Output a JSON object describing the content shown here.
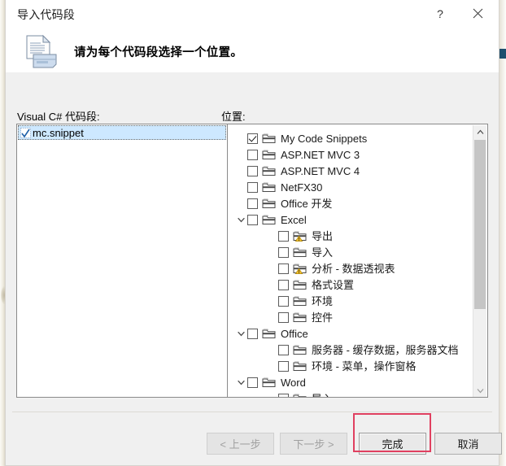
{
  "window": {
    "title": "导入代码段",
    "help_label": "?",
    "close_label": "×"
  },
  "header": {
    "instruction": "请为每个代码段选择一个位置。",
    "icon": "snippet-document-icon"
  },
  "left_panel": {
    "label": "Visual C# 代码段:",
    "items": [
      {
        "label": "mc.snippet",
        "checked": true,
        "selected": true
      }
    ]
  },
  "right_panel": {
    "label": "位置:",
    "tree": [
      {
        "label": "My Code Snippets",
        "checked": true,
        "depth": 0,
        "expander": "none",
        "warn": false
      },
      {
        "label": "ASP.NET MVC 3",
        "checked": false,
        "depth": 0,
        "expander": "none",
        "warn": false
      },
      {
        "label": "ASP.NET MVC 4",
        "checked": false,
        "depth": 0,
        "expander": "none",
        "warn": false
      },
      {
        "label": "NetFX30",
        "checked": false,
        "depth": 0,
        "expander": "none",
        "warn": false
      },
      {
        "label": "Office 开发",
        "checked": false,
        "depth": 0,
        "expander": "none",
        "warn": false
      },
      {
        "label": "Excel",
        "checked": false,
        "depth": 0,
        "expander": "expanded",
        "warn": false
      },
      {
        "label": "导出",
        "checked": false,
        "depth": 1,
        "expander": "none",
        "warn": true
      },
      {
        "label": "导入",
        "checked": false,
        "depth": 1,
        "expander": "none",
        "warn": false
      },
      {
        "label": "分析 - 数据透视表",
        "checked": false,
        "depth": 1,
        "expander": "none",
        "warn": true
      },
      {
        "label": "格式设置",
        "checked": false,
        "depth": 1,
        "expander": "none",
        "warn": false
      },
      {
        "label": "环境",
        "checked": false,
        "depth": 1,
        "expander": "none",
        "warn": false
      },
      {
        "label": "控件",
        "checked": false,
        "depth": 1,
        "expander": "none",
        "warn": false
      },
      {
        "label": "Office",
        "checked": false,
        "depth": 0,
        "expander": "expanded",
        "warn": false
      },
      {
        "label": "服务器 - 缓存数据，服务器文档",
        "checked": false,
        "depth": 1,
        "expander": "none",
        "warn": false
      },
      {
        "label": "环境 - 菜单，操作窗格",
        "checked": false,
        "depth": 1,
        "expander": "none",
        "warn": false
      },
      {
        "label": "Word",
        "checked": false,
        "depth": 0,
        "expander": "expanded",
        "warn": false
      },
      {
        "label": "导入",
        "checked": false,
        "depth": 1,
        "expander": "none",
        "warn": true
      }
    ],
    "scrollbar": {
      "up_arrow": "▲",
      "down_arrow": "▼"
    }
  },
  "footer": {
    "buttons": [
      {
        "id": "back",
        "label": "< 上一步",
        "state": "disabled"
      },
      {
        "id": "next",
        "label": "下一步 >",
        "state": "disabled"
      },
      {
        "id": "finish",
        "label": "完成",
        "state": "default"
      },
      {
        "id": "cancel",
        "label": "取消",
        "state": "default"
      }
    ]
  },
  "annotation": {
    "color": "#e04060",
    "target": "完成"
  }
}
